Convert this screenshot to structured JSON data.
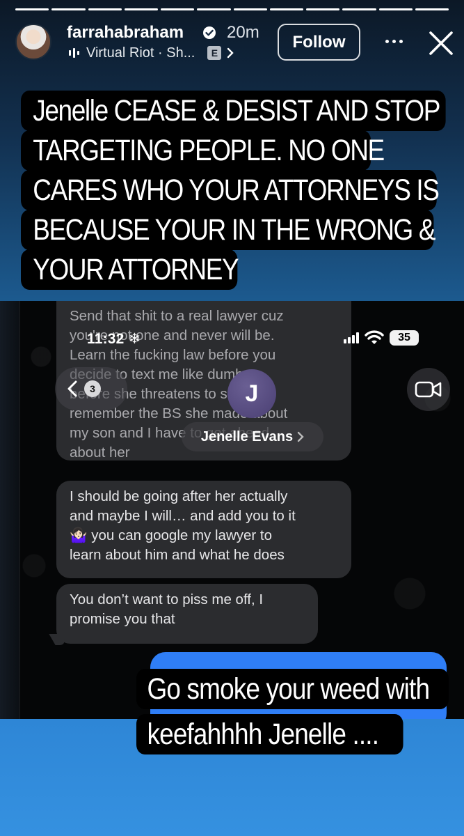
{
  "story": {
    "username": "farrahabraham",
    "time_ago": "20m",
    "music": "Virtual Riot · Sh...",
    "explicit_badge": "E",
    "follow_label": "Follow",
    "progress_segments": 12,
    "progress_active": 12,
    "overlay_text_top": [
      "Jenelle CEASE & DESIST AND STOP",
      "TARGETING PEOPLE. NO ONE",
      "CARES WHO YOUR ATTORNEYS IS",
      "BECAUSE YOUR IN THE WRONG &",
      "YOUR ATTORNEY"
    ],
    "overlay_text_bottom": [
      "Go smoke your weed with",
      "keefahhhh Jenelle ...."
    ]
  },
  "screenshot": {
    "status": {
      "time": "11:32",
      "battery": "35"
    },
    "back_count": "3",
    "contact_initial": "J",
    "contact_name": "Jenelle Evans",
    "messages": [
      {
        "text": "Send that shit to a real lawyer cuz\nyou're not one and never will be.\nLearn the fucking law before you\ndecide to text me like dumb\nbefore she threatens to sue\nremember the BS she made about\nmy son and I have to get ahead\nabout her"
      },
      {
        "text": "I should be going after her actually\nand maybe I will… and add you to it\n🤷🏻‍♀️ you can google my lawyer to\nlearn about him and what he does"
      },
      {
        "text": "You don’t want to piss me off, I\npromise you that"
      }
    ]
  },
  "colors": {
    "incoming_bubble": "#2b2c2f",
    "outgoing_bubble": "#2f7ef6",
    "bottom_band": "#3591e0"
  }
}
